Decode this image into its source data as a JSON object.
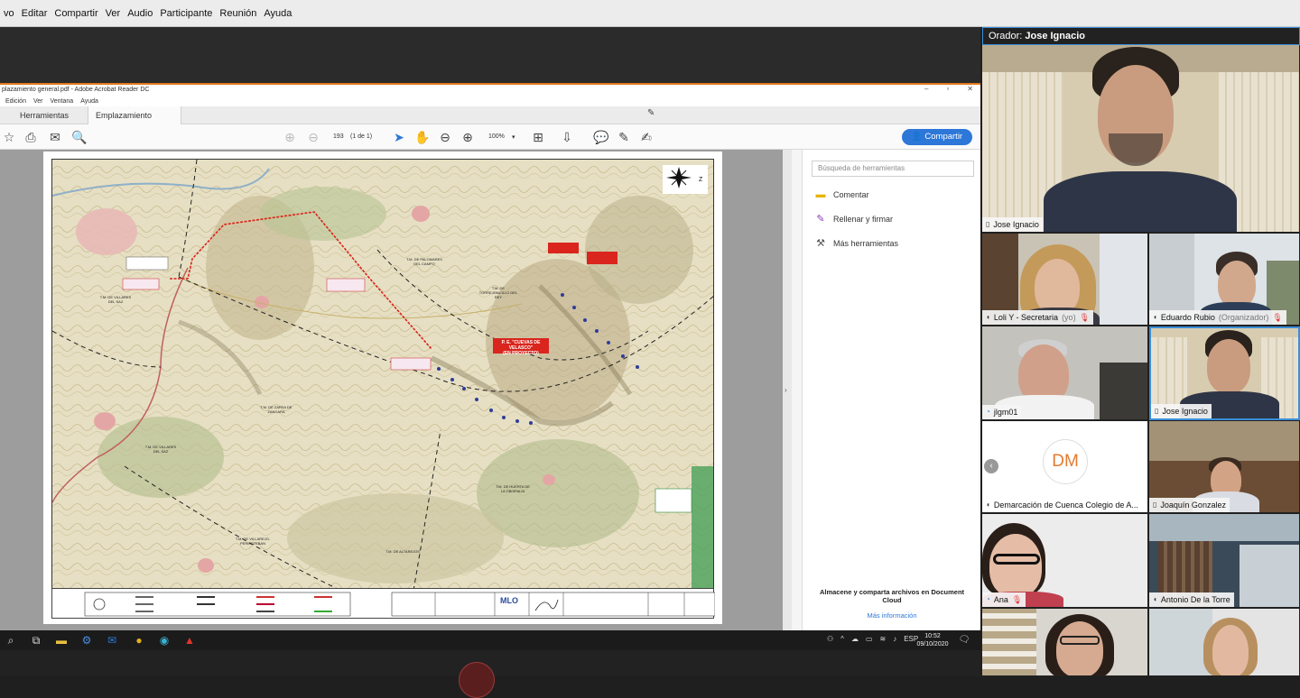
{
  "menubar": {
    "items": [
      "vo",
      "Editar",
      "Compartir",
      "Ver",
      "Audio",
      "Participante",
      "Reunión",
      "Ayuda"
    ]
  },
  "acrobat": {
    "title": "plazamiento general.pdf - Adobe Acrobat Reader DC",
    "menu": [
      "Edición",
      "Ver",
      "Ventana",
      "Ayuda"
    ],
    "tab_tools": "Herramientas",
    "tab_doc": "Emplazamiento gen...",
    "page_num": "193",
    "page_of": "(1 de 1)",
    "zoom": "100%",
    "share_label": "Compartir",
    "search_placeholder": "Búsqueda de herramientas",
    "tools": [
      "Comentar",
      "Rellenar y firmar",
      "Más herramientas"
    ],
    "cloud_text": "Almacene y comparta archivos en Document Cloud",
    "more_info": "Más información"
  },
  "map_labels": {
    "project_box": "P. E. \"CUEVAS DE VELASCO\"",
    "project_sub": "(EN PROYECTO)",
    "tm_palomares": "T.M. DE PALOMARES DEL CAMPO",
    "tm_torrejoncillo": "T.M. DE TORREJONCILLO DEL REY",
    "tm_villares": "T.M. DE VILLARES DEL SAZ",
    "tm_zafra": "T.M. DE ZAFRA DE ZANCARA",
    "tm_villares2": "T.M. DE VILLARES DEL SAZ",
    "tm_huerta": "T.M. DE HUERTA DE LA OBISPALIA",
    "tm_villarejo": "T.M. DE VILLAREJO-PERIESTEBAN",
    "tm_altarejos": "T.M. DE ALTAREJOS"
  },
  "taskbar": {
    "time": "10:52",
    "date": "09/10/2020",
    "lang": "ESP"
  },
  "speaker": {
    "prefix": "Orador:",
    "name": "Jose Ignacio"
  },
  "participants": [
    {
      "name": "Jose Ignacio",
      "extra": ""
    },
    {
      "name": "Loli Y - Secretaria",
      "extra": "(yo)"
    },
    {
      "name": "Eduardo Rubio",
      "extra": "(Organizador)"
    },
    {
      "name": "jlgm01",
      "extra": ""
    },
    {
      "name": "Jose Ignacio",
      "extra": ""
    },
    {
      "name": "Demarcación de Cuenca Colegio de A...",
      "extra": ""
    },
    {
      "name": "Joaquín Gonzalez",
      "extra": ""
    },
    {
      "name": "Ana",
      "extra": ""
    },
    {
      "name": "Antonio De la Torre",
      "extra": ""
    }
  ],
  "dm_initials": "DM",
  "colors": {
    "accent_blue": "#2c77d8",
    "share_border": "#e27a1f",
    "route_red": "#d9251d"
  }
}
